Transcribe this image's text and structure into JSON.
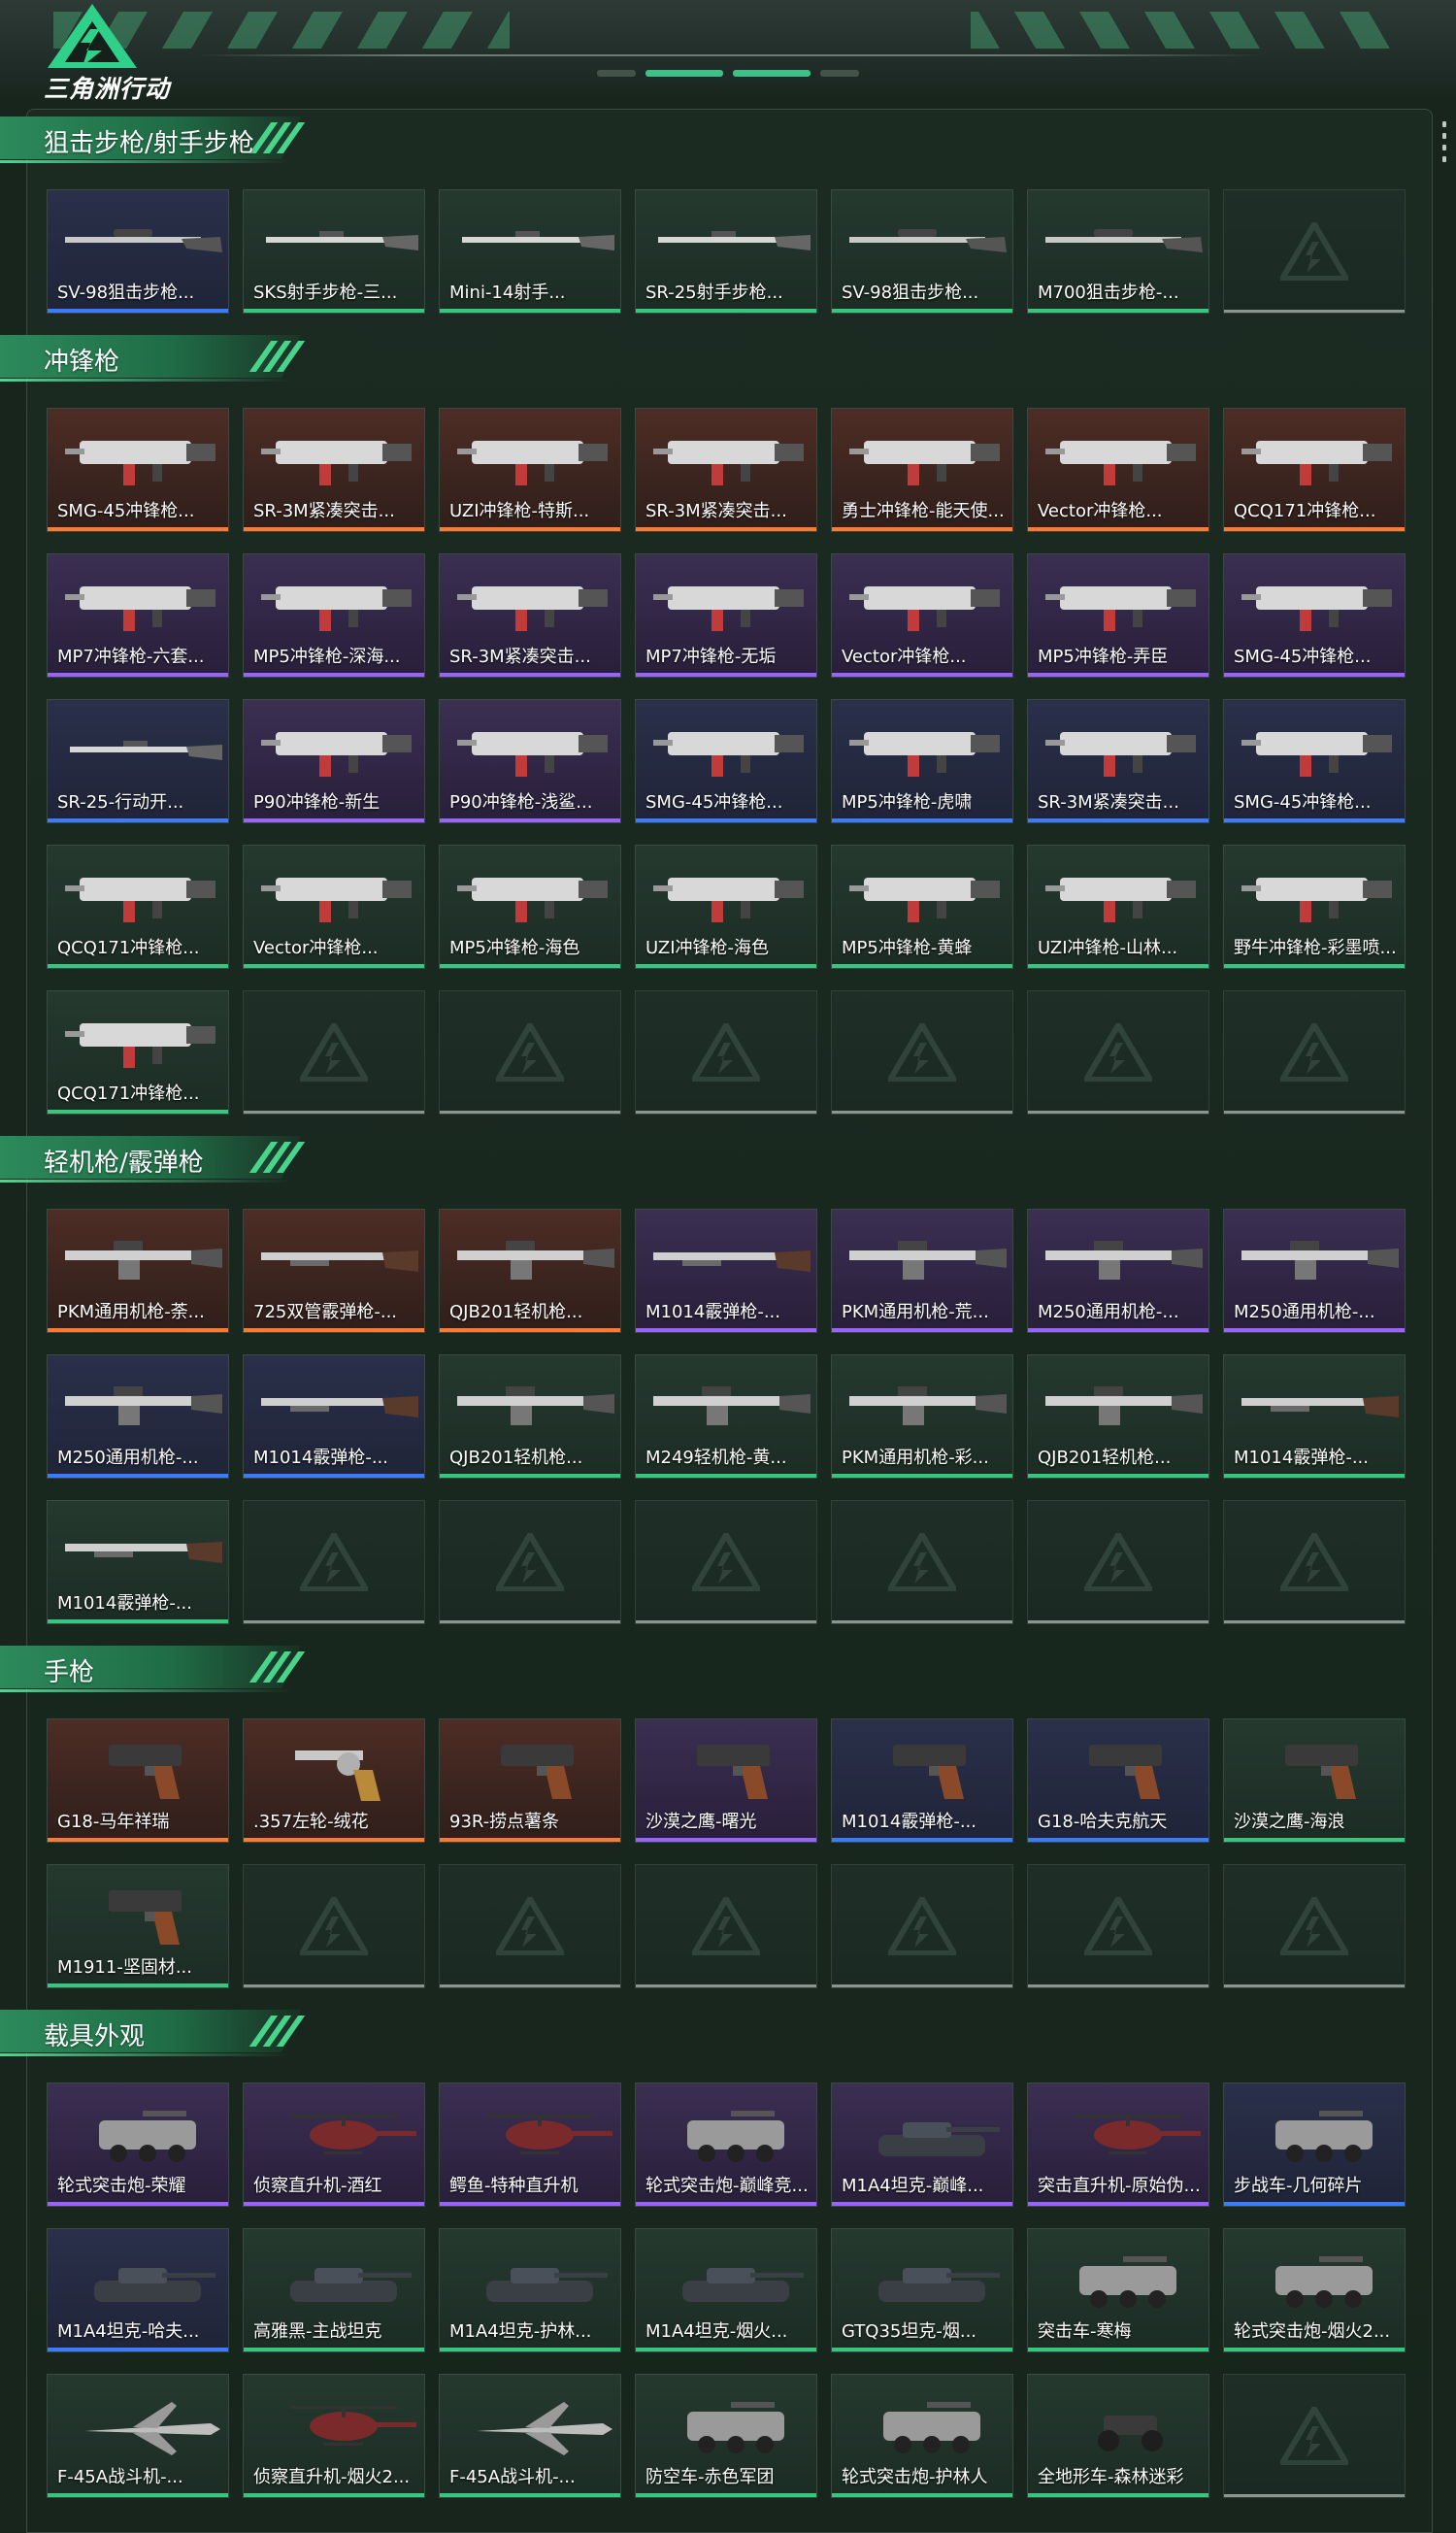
{
  "app": {
    "logo_text": "三角洲行动"
  },
  "sections": [
    {
      "title": "狙击步枪/射手步枪",
      "items": [
        {
          "label": "SV-98狙击步枪...",
          "quality": "blue",
          "icon": "sniper-rifle-icon"
        },
        {
          "label": "SKS射手步枪-三...",
          "quality": "green",
          "icon": "rifle-icon"
        },
        {
          "label": "Mini-14射手...",
          "quality": "green",
          "icon": "rifle-icon"
        },
        {
          "label": "SR-25射手步枪...",
          "quality": "green",
          "icon": "rifle-icon"
        },
        {
          "label": "SV-98狙击步枪...",
          "quality": "green",
          "icon": "sniper-rifle-icon"
        },
        {
          "label": "M700狙击步枪-...",
          "quality": "green",
          "icon": "sniper-rifle-icon"
        },
        {
          "empty": true
        }
      ]
    },
    {
      "title": "冲锋枪",
      "items": [
        {
          "label": "SMG-45冲锋枪...",
          "quality": "red",
          "icon": "smg-icon"
        },
        {
          "label": "SR-3M紧凑突击...",
          "quality": "red",
          "icon": "smg-icon"
        },
        {
          "label": "UZI冲锋枪-特斯...",
          "quality": "red",
          "icon": "smg-icon"
        },
        {
          "label": "SR-3M紧凑突击...",
          "quality": "red",
          "icon": "smg-icon"
        },
        {
          "label": "勇士冲锋枪-能天使...",
          "quality": "red",
          "icon": "smg-icon"
        },
        {
          "label": "Vector冲锋枪...",
          "quality": "red",
          "icon": "smg-icon"
        },
        {
          "label": "QCQ171冲锋枪...",
          "quality": "red",
          "icon": "smg-icon"
        },
        {
          "label": "MP7冲锋枪-六套...",
          "quality": "purple",
          "icon": "smg-icon"
        },
        {
          "label": "MP5冲锋枪-深海...",
          "quality": "purple",
          "icon": "smg-icon"
        },
        {
          "label": "SR-3M紧凑突击...",
          "quality": "purple",
          "icon": "smg-icon"
        },
        {
          "label": "MP7冲锋枪-无垢",
          "quality": "purple",
          "icon": "smg-icon"
        },
        {
          "label": "Vector冲锋枪...",
          "quality": "purple",
          "icon": "smg-icon"
        },
        {
          "label": "MP5冲锋枪-弄臣",
          "quality": "purple",
          "icon": "smg-icon"
        },
        {
          "label": "SMG-45冲锋枪...",
          "quality": "purple",
          "icon": "smg-icon"
        },
        {
          "label": "SR-25-行动开...",
          "quality": "blue",
          "icon": "rifle-icon"
        },
        {
          "label": "P90冲锋枪-新生",
          "quality": "purple",
          "icon": "smg-icon"
        },
        {
          "label": "P90冲锋枪-浅鲨...",
          "quality": "purple",
          "icon": "smg-icon"
        },
        {
          "label": "SMG-45冲锋枪...",
          "quality": "blue",
          "icon": "smg-icon"
        },
        {
          "label": "MP5冲锋枪-虎啸",
          "quality": "blue",
          "icon": "smg-icon"
        },
        {
          "label": "SR-3M紧凑突击...",
          "quality": "blue",
          "icon": "smg-icon"
        },
        {
          "label": "SMG-45冲锋枪...",
          "quality": "blue",
          "icon": "smg-icon"
        },
        {
          "label": "QCQ171冲锋枪...",
          "quality": "green",
          "icon": "smg-icon"
        },
        {
          "label": "Vector冲锋枪...",
          "quality": "green",
          "icon": "smg-icon"
        },
        {
          "label": "MP5冲锋枪-海色",
          "quality": "green",
          "icon": "smg-icon"
        },
        {
          "label": "UZI冲锋枪-海色",
          "quality": "green",
          "icon": "smg-icon"
        },
        {
          "label": "MP5冲锋枪-黄蜂",
          "quality": "green",
          "icon": "smg-icon"
        },
        {
          "label": "UZI冲锋枪-山林...",
          "quality": "green",
          "icon": "smg-icon"
        },
        {
          "label": "野牛冲锋枪-彩墨喷...",
          "quality": "green",
          "icon": "smg-icon"
        },
        {
          "label": "QCQ171冲锋枪...",
          "quality": "green",
          "icon": "smg-icon"
        },
        {
          "empty": true
        },
        {
          "empty": true
        },
        {
          "empty": true
        },
        {
          "empty": true
        },
        {
          "empty": true
        },
        {
          "empty": true
        }
      ]
    },
    {
      "title": "轻机枪/霰弹枪",
      "items": [
        {
          "label": "PKM通用机枪-荼...",
          "quality": "red",
          "icon": "machine-gun-icon"
        },
        {
          "label": "725双管霰弹枪-...",
          "quality": "red",
          "icon": "shotgun-icon"
        },
        {
          "label": "QJB201轻机枪...",
          "quality": "red",
          "icon": "machine-gun-icon"
        },
        {
          "label": "M1014霰弹枪-...",
          "quality": "purple",
          "icon": "shotgun-icon"
        },
        {
          "label": "PKM通用机枪-荒...",
          "quality": "purple",
          "icon": "machine-gun-icon"
        },
        {
          "label": "M250通用机枪-...",
          "quality": "purple",
          "icon": "machine-gun-icon"
        },
        {
          "label": "M250通用机枪-...",
          "quality": "purple",
          "icon": "machine-gun-icon"
        },
        {
          "label": "M250通用机枪-...",
          "quality": "blue",
          "icon": "machine-gun-icon"
        },
        {
          "label": "M1014霰弹枪-...",
          "quality": "blue",
          "icon": "shotgun-icon"
        },
        {
          "label": "QJB201轻机枪...",
          "quality": "green",
          "icon": "machine-gun-icon"
        },
        {
          "label": "M249轻机枪-黄...",
          "quality": "green",
          "icon": "machine-gun-icon"
        },
        {
          "label": "PKM通用机枪-彩...",
          "quality": "green",
          "icon": "machine-gun-icon"
        },
        {
          "label": "QJB201轻机枪...",
          "quality": "green",
          "icon": "machine-gun-icon"
        },
        {
          "label": "M1014霰弹枪-...",
          "quality": "green",
          "icon": "shotgun-icon"
        },
        {
          "label": "M1014霰弹枪-...",
          "quality": "green",
          "icon": "shotgun-icon"
        },
        {
          "empty": true
        },
        {
          "empty": true
        },
        {
          "empty": true
        },
        {
          "empty": true
        },
        {
          "empty": true
        },
        {
          "empty": true
        }
      ]
    },
    {
      "title": "手枪",
      "items": [
        {
          "label": "G18-马年祥瑞",
          "quality": "red",
          "icon": "pistol-icon"
        },
        {
          "label": ".357左轮-绒花",
          "quality": "red",
          "icon": "revolver-icon"
        },
        {
          "label": "93R-捞点薯条",
          "quality": "red",
          "icon": "pistol-icon"
        },
        {
          "label": "沙漠之鹰-曙光",
          "quality": "purple",
          "icon": "pistol-icon"
        },
        {
          "label": "M1014霰弹枪-...",
          "quality": "blue",
          "icon": "pistol-icon"
        },
        {
          "label": "G18-哈夫克航天",
          "quality": "blue",
          "icon": "pistol-icon"
        },
        {
          "label": "沙漠之鹰-海浪",
          "quality": "green",
          "icon": "pistol-icon"
        },
        {
          "label": "M1911-坚固材...",
          "quality": "green",
          "icon": "pistol-icon"
        },
        {
          "empty": true
        },
        {
          "empty": true
        },
        {
          "empty": true
        },
        {
          "empty": true
        },
        {
          "empty": true
        },
        {
          "empty": true
        }
      ]
    },
    {
      "title": "载具外观",
      "items": [
        {
          "label": "轮式突击炮-荣耀",
          "quality": "purple",
          "icon": "armored-car-icon"
        },
        {
          "label": "侦察直升机-酒红",
          "quality": "purple",
          "icon": "helicopter-icon"
        },
        {
          "label": "鳄鱼-特种直升机",
          "quality": "purple",
          "icon": "helicopter-icon"
        },
        {
          "label": "轮式突击炮-巅峰竞...",
          "quality": "purple",
          "icon": "armored-car-icon"
        },
        {
          "label": "M1A4坦克-巅峰...",
          "quality": "purple",
          "icon": "tank-icon"
        },
        {
          "label": "突击直升机-原始伪...",
          "quality": "purple",
          "icon": "helicopter-icon"
        },
        {
          "label": "步战车-几何碎片",
          "quality": "blue",
          "icon": "armored-car-icon"
        },
        {
          "label": "M1A4坦克-哈夫...",
          "quality": "blue",
          "icon": "tank-icon"
        },
        {
          "label": "高雅黑-主战坦克",
          "quality": "green",
          "icon": "tank-icon"
        },
        {
          "label": "M1A4坦克-护林...",
          "quality": "green",
          "icon": "tank-icon"
        },
        {
          "label": "M1A4坦克-烟火...",
          "quality": "green",
          "icon": "tank-icon"
        },
        {
          "label": "GTQ35坦克-烟...",
          "quality": "green",
          "icon": "tank-icon"
        },
        {
          "label": "突击车-寒梅",
          "quality": "green",
          "icon": "armored-car-icon"
        },
        {
          "label": "轮式突击炮-烟火2...",
          "quality": "green",
          "icon": "armored-car-icon"
        },
        {
          "label": "F-45A战斗机-...",
          "quality": "green",
          "icon": "jet-icon"
        },
        {
          "label": "侦察直升机-烟火2...",
          "quality": "green",
          "icon": "helicopter-icon"
        },
        {
          "label": "F-45A战斗机-...",
          "quality": "green",
          "icon": "jet-icon"
        },
        {
          "label": "防空车-赤色军团",
          "quality": "green",
          "icon": "armored-car-icon"
        },
        {
          "label": "轮式突击炮-护林人",
          "quality": "green",
          "icon": "armored-car-icon"
        },
        {
          "label": "全地形车-森林迷彩",
          "quality": "green",
          "icon": "atv-icon"
        },
        {
          "empty": true
        }
      ]
    }
  ]
}
